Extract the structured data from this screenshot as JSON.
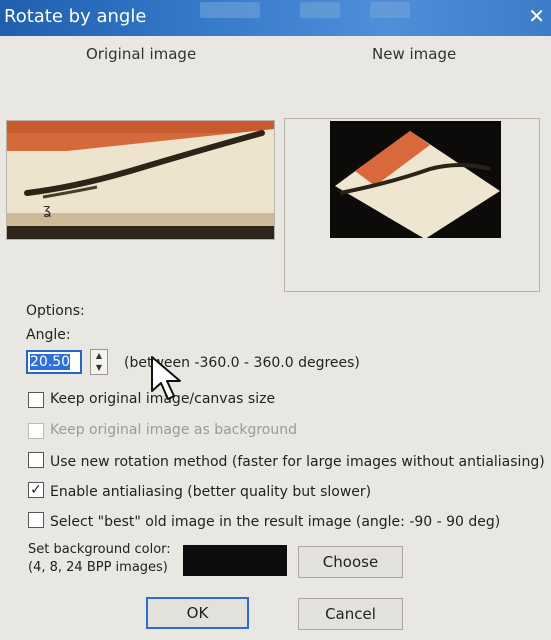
{
  "window": {
    "title": "Rotate by angle"
  },
  "preview": {
    "original_label": "Original image",
    "new_label": "New image"
  },
  "options": {
    "heading": "Options:",
    "angle_label": "Angle:",
    "angle_value": "20.50",
    "angle_range": "(between -360.0  -  360.0 degrees)",
    "checkboxes": [
      {
        "label": "Keep original image/canvas size",
        "checked": false,
        "enabled": true
      },
      {
        "label": "Keep original image as background",
        "checked": false,
        "enabled": false
      },
      {
        "label": "Use new rotation method (faster for large images without antialiasing)",
        "checked": false,
        "enabled": true
      },
      {
        "label": "Enable antialiasing (better quality but slower)",
        "checked": true,
        "enabled": true
      },
      {
        "label": "Select \"best\" old image in the result image (angle: -90 - 90 deg)",
        "checked": false,
        "enabled": true
      }
    ],
    "bg_color_label_1": "Set background color:",
    "bg_color_label_2": "(4, 8, 24 BPP images)",
    "bg_color": "#0c0c0c",
    "choose_label": "Choose"
  },
  "buttons": {
    "ok": "OK",
    "cancel": "Cancel"
  },
  "icons": {
    "spin_up": "spin-up-icon",
    "spin_down": "spin-down-icon",
    "check": "check-icon",
    "cursor": "mouse-cursor-icon"
  }
}
